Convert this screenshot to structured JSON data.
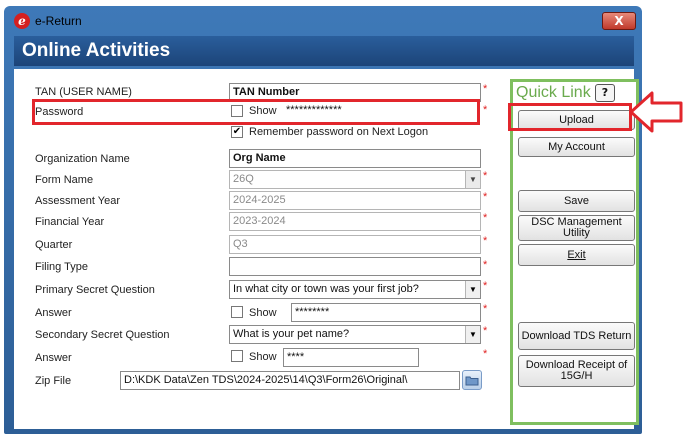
{
  "window": {
    "title": "e-Return",
    "close_symbol": "X",
    "app_icon_letter": "e"
  },
  "header": {
    "title": "Online Activities"
  },
  "form": {
    "tan_label": "TAN (USER NAME)",
    "tan_value": "TAN Number",
    "password_label": "Password",
    "password_show_label": "Show",
    "password_value": "*************",
    "remember_label": "Remember password on Next Logon",
    "remember_checked": true,
    "org_label": "Organization Name",
    "org_value": "Org Name",
    "form_name_label": "Form Name",
    "form_name_value": "26Q",
    "ay_label": "Assessment Year",
    "ay_value": "2024-2025",
    "fy_label": "Financial Year",
    "fy_value": "2023-2024",
    "quarter_label": "Quarter",
    "quarter_value": "Q3",
    "filing_type_label": "Filing Type",
    "filing_type_value": "",
    "psq_label": "Primary Secret Question",
    "psq_value": "In what city or town was your first job?",
    "answer1_label": "Answer",
    "answer1_show_label": "Show",
    "answer1_value": "********",
    "ssq_label": "Secondary Secret Question",
    "ssq_value": "What is your pet name?",
    "answer2_label": "Answer",
    "answer2_show_label": "Show",
    "answer2_value": "****",
    "zip_label": "Zip File",
    "zip_value": "D:\\KDK Data\\Zen TDS\\2024-2025\\14\\Q3\\Form26\\Original\\",
    "required_mark": "*"
  },
  "quick_link": {
    "title": "Quick Link",
    "help_label": "?",
    "upload": "Upload",
    "my_account": "My Account",
    "save": "Save",
    "dsc": "DSC Management Utility",
    "exit": "Exit",
    "download_tds": "Download TDS Return",
    "download_receipt": "Download Receipt of 15G/H"
  },
  "colors": {
    "highlight_red": "#e2262c",
    "quick_link_green": "#7fbf5f",
    "header_blue": "#1c4478"
  }
}
